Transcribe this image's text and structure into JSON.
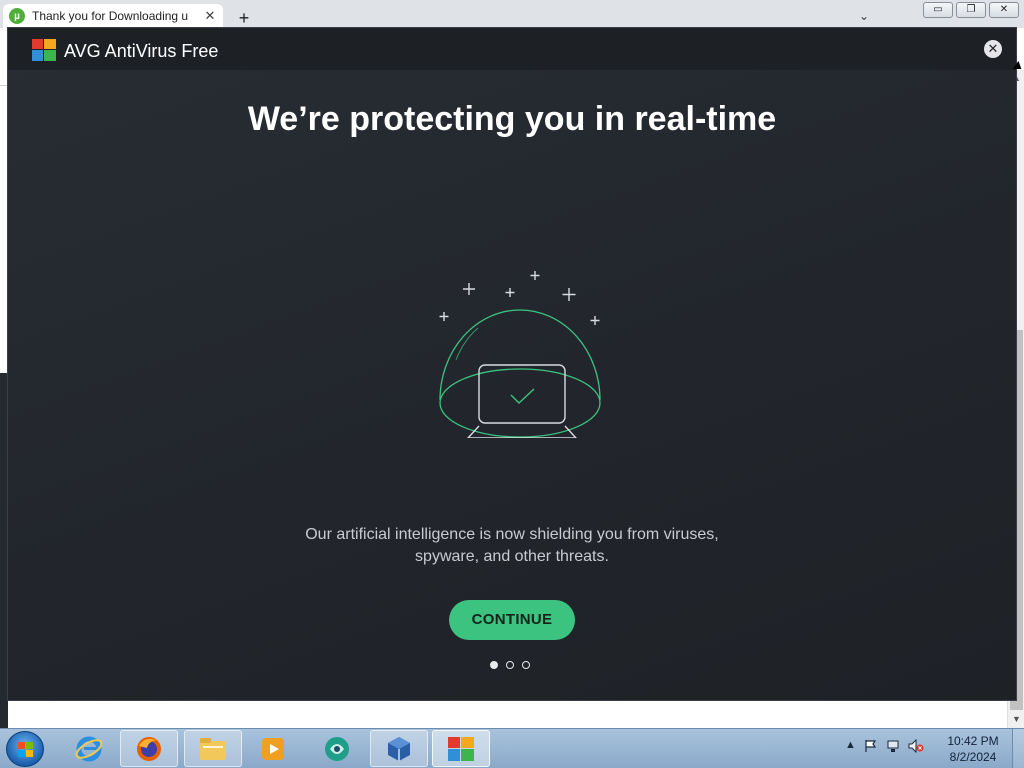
{
  "browser": {
    "tab_title": "Thank you for Downloading u",
    "tab_close": "✕",
    "new_tab": "+",
    "tab_search": "⌄",
    "controls": {
      "minimize": "▭",
      "restore": "❐",
      "close": "✕"
    }
  },
  "dialog": {
    "title": "AVG AntiVirus Free",
    "close": "✕",
    "headline": "We’re protecting you in real-time",
    "body_line1": "Our artificial intelligence is now shielding you from viruses,",
    "body_line2": "spyware, and other threats.",
    "continue_label": "CONTINUE",
    "pager": {
      "total": 3,
      "active": 1
    },
    "accent": "#3cc37f",
    "background": "#22262c"
  },
  "taskbar": {
    "apps": [
      {
        "name": "internet-explorer-icon"
      },
      {
        "name": "firefox-icon"
      },
      {
        "name": "file-explorer-icon"
      },
      {
        "name": "media-player-icon"
      },
      {
        "name": "app-globe-icon"
      },
      {
        "name": "virtualbox-icon"
      },
      {
        "name": "avg-icon"
      }
    ],
    "time": "10:42 PM",
    "date": "8/2/2024"
  }
}
